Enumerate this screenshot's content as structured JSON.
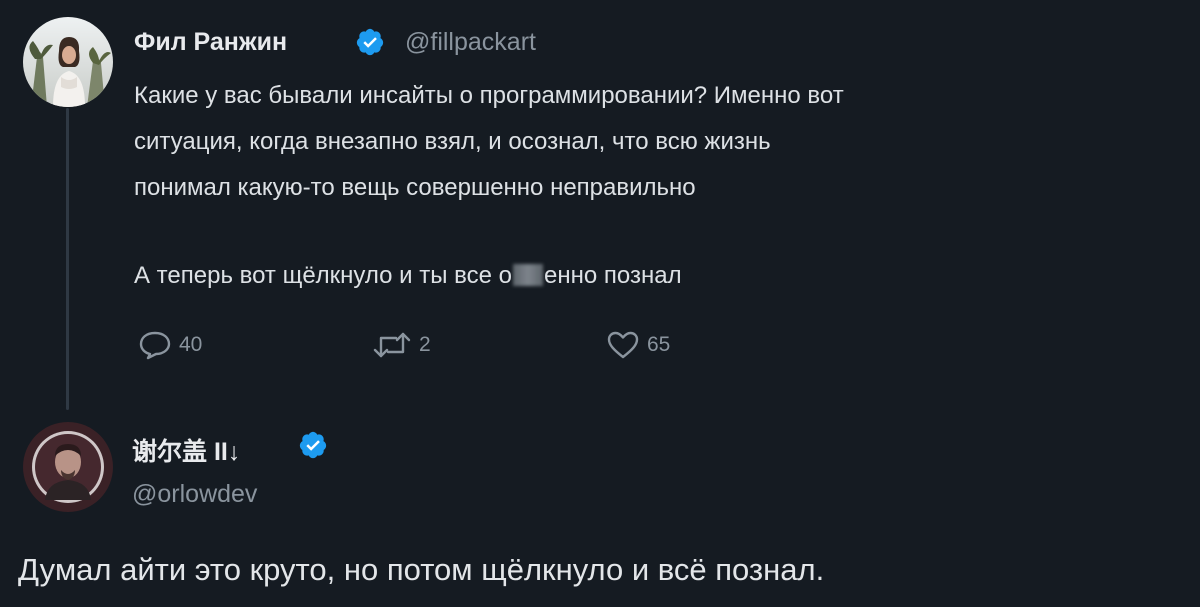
{
  "tweet": {
    "author_name": "Фил Ранжин",
    "author_handle": "@fillpackart",
    "lines": [
      "Какие у вас бывали инсайты о программировании? Именно вот",
      "ситуация, когда внезапно взял, и осознал, что всю жизнь",
      "понимал какую-то вещь совершенно неправильно"
    ],
    "line4_before": "А теперь вот щёлкнуло и ты все о",
    "line4_after": "енно познал",
    "replies_count": "40",
    "retweets_count": "2",
    "likes_count": "65"
  },
  "reply": {
    "author_name": "谢尔盖 II↓",
    "author_handle": "@orlowdev",
    "text": "Думал айти это круто, но потом щёлкнуло и всё познал."
  },
  "colors": {
    "background": "#151b22",
    "verified": "#1d9bf0",
    "muted": "#8a949e"
  },
  "icons": [
    "verified-badge-icon",
    "reply-icon",
    "retweet-icon",
    "like-icon"
  ]
}
